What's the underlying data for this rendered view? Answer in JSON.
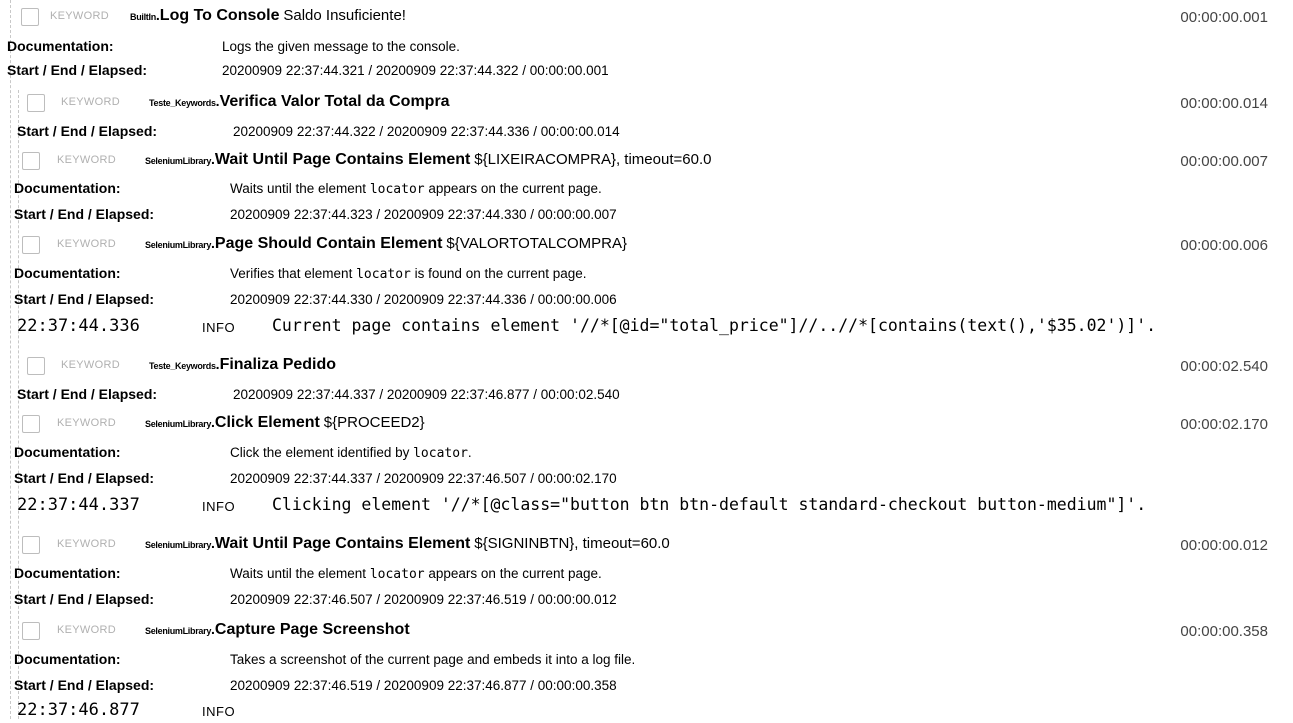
{
  "labels": {
    "keyword": "KEYWORD",
    "documentation": "Documentation:",
    "start_end": "Start / End / Elapsed:",
    "info": "INFO"
  },
  "k1": {
    "lib": "BuiltIn",
    "name": "Log To Console",
    "args": "Saldo Insuficiente!",
    "elapsed": "00:00:00.001",
    "doc": "Logs the given message to the console.",
    "times": "20200909 22:37:44.321 / 20200909 22:37:44.322 / 00:00:00.001"
  },
  "k2": {
    "lib": "Teste_Keywords",
    "name": "Verifica Valor Total da Compra",
    "elapsed": "00:00:00.014",
    "times": "20200909 22:37:44.322 / 20200909 22:37:44.336 / 00:00:00.014"
  },
  "k3": {
    "lib": "SeleniumLibrary",
    "name": "Wait Until Page Contains Element",
    "args": "${LIXEIRACOMPRA}, timeout=60.0",
    "elapsed": "00:00:00.007",
    "doc_pre": "Waits until the element",
    "doc_code": "locator",
    "doc_post": "appears on the current page.",
    "times": "20200909 22:37:44.323 / 20200909 22:37:44.330 / 00:00:00.007"
  },
  "k4": {
    "lib": "SeleniumLibrary",
    "name": "Page Should Contain Element",
    "args": "${VALORTOTALCOMPRA}",
    "elapsed": "00:00:00.006",
    "doc_pre": "Verifies that element",
    "doc_code": "locator",
    "doc_post": "is found on the current page.",
    "times": "20200909 22:37:44.330 / 20200909 22:37:44.336 / 00:00:00.006",
    "msg_ts": "22:37:44.336",
    "msg": "Current page contains element '//*[@id=\"total_price\"]//..//*[contains(text(),'$35.02')]'."
  },
  "k5": {
    "lib": "Teste_Keywords",
    "name": "Finaliza Pedido",
    "elapsed": "00:00:02.540",
    "times": "20200909 22:37:44.337 / 20200909 22:37:46.877 / 00:00:02.540"
  },
  "k6": {
    "lib": "SeleniumLibrary",
    "name": "Click Element",
    "args": "${PROCEED2}",
    "elapsed": "00:00:02.170",
    "doc_pre": "Click the element identified by",
    "doc_code": "locator",
    "doc_post": ".",
    "times": "20200909 22:37:44.337 / 20200909 22:37:46.507 / 00:00:02.170",
    "msg_ts": "22:37:44.337",
    "msg": "Clicking element '//*[@class=\"button btn btn-default standard-checkout button-medium\"]'."
  },
  "k7": {
    "lib": "SeleniumLibrary",
    "name": "Wait Until Page Contains Element",
    "args": "${SIGNINBTN}, timeout=60.0",
    "elapsed": "00:00:00.012",
    "doc_pre": "Waits until the element",
    "doc_code": "locator",
    "doc_post": "appears on the current page.",
    "times": "20200909 22:37:46.507 / 20200909 22:37:46.519 / 00:00:00.012"
  },
  "k8": {
    "lib": "SeleniumLibrary",
    "name": "Capture Page Screenshot",
    "elapsed": "00:00:00.358",
    "doc": "Takes a screenshot of the current page and embeds it into a log file.",
    "times": "20200909 22:37:46.519 / 20200909 22:37:46.877 / 00:00:00.358",
    "msg_ts": "22:37:46.877"
  }
}
